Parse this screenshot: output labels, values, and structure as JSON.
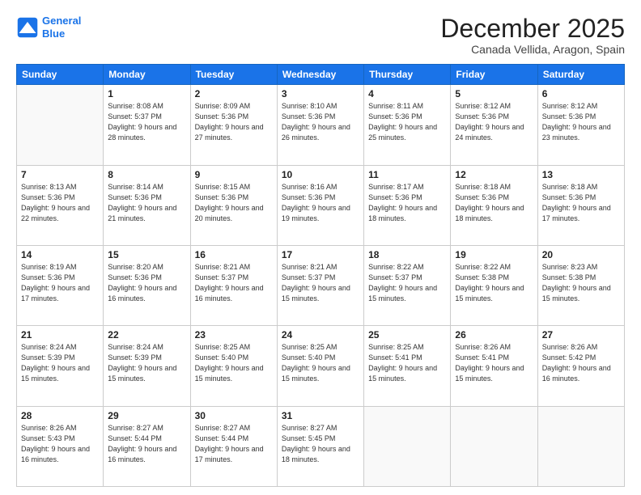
{
  "logo": {
    "line1": "General",
    "line2": "Blue"
  },
  "title": "December 2025",
  "subtitle": "Canada Vellida, Aragon, Spain",
  "weekdays": [
    "Sunday",
    "Monday",
    "Tuesday",
    "Wednesday",
    "Thursday",
    "Friday",
    "Saturday"
  ],
  "weeks": [
    [
      {
        "day": "",
        "info": ""
      },
      {
        "day": "1",
        "info": "Sunrise: 8:08 AM\nSunset: 5:37 PM\nDaylight: 9 hours\nand 28 minutes."
      },
      {
        "day": "2",
        "info": "Sunrise: 8:09 AM\nSunset: 5:36 PM\nDaylight: 9 hours\nand 27 minutes."
      },
      {
        "day": "3",
        "info": "Sunrise: 8:10 AM\nSunset: 5:36 PM\nDaylight: 9 hours\nand 26 minutes."
      },
      {
        "day": "4",
        "info": "Sunrise: 8:11 AM\nSunset: 5:36 PM\nDaylight: 9 hours\nand 25 minutes."
      },
      {
        "day": "5",
        "info": "Sunrise: 8:12 AM\nSunset: 5:36 PM\nDaylight: 9 hours\nand 24 minutes."
      },
      {
        "day": "6",
        "info": "Sunrise: 8:12 AM\nSunset: 5:36 PM\nDaylight: 9 hours\nand 23 minutes."
      }
    ],
    [
      {
        "day": "7",
        "info": "Sunrise: 8:13 AM\nSunset: 5:36 PM\nDaylight: 9 hours\nand 22 minutes."
      },
      {
        "day": "8",
        "info": "Sunrise: 8:14 AM\nSunset: 5:36 PM\nDaylight: 9 hours\nand 21 minutes."
      },
      {
        "day": "9",
        "info": "Sunrise: 8:15 AM\nSunset: 5:36 PM\nDaylight: 9 hours\nand 20 minutes."
      },
      {
        "day": "10",
        "info": "Sunrise: 8:16 AM\nSunset: 5:36 PM\nDaylight: 9 hours\nand 19 minutes."
      },
      {
        "day": "11",
        "info": "Sunrise: 8:17 AM\nSunset: 5:36 PM\nDaylight: 9 hours\nand 18 minutes."
      },
      {
        "day": "12",
        "info": "Sunrise: 8:18 AM\nSunset: 5:36 PM\nDaylight: 9 hours\nand 18 minutes."
      },
      {
        "day": "13",
        "info": "Sunrise: 8:18 AM\nSunset: 5:36 PM\nDaylight: 9 hours\nand 17 minutes."
      }
    ],
    [
      {
        "day": "14",
        "info": "Sunrise: 8:19 AM\nSunset: 5:36 PM\nDaylight: 9 hours\nand 17 minutes."
      },
      {
        "day": "15",
        "info": "Sunrise: 8:20 AM\nSunset: 5:36 PM\nDaylight: 9 hours\nand 16 minutes."
      },
      {
        "day": "16",
        "info": "Sunrise: 8:21 AM\nSunset: 5:37 PM\nDaylight: 9 hours\nand 16 minutes."
      },
      {
        "day": "17",
        "info": "Sunrise: 8:21 AM\nSunset: 5:37 PM\nDaylight: 9 hours\nand 15 minutes."
      },
      {
        "day": "18",
        "info": "Sunrise: 8:22 AM\nSunset: 5:37 PM\nDaylight: 9 hours\nand 15 minutes."
      },
      {
        "day": "19",
        "info": "Sunrise: 8:22 AM\nSunset: 5:38 PM\nDaylight: 9 hours\nand 15 minutes."
      },
      {
        "day": "20",
        "info": "Sunrise: 8:23 AM\nSunset: 5:38 PM\nDaylight: 9 hours\nand 15 minutes."
      }
    ],
    [
      {
        "day": "21",
        "info": "Sunrise: 8:24 AM\nSunset: 5:39 PM\nDaylight: 9 hours\nand 15 minutes."
      },
      {
        "day": "22",
        "info": "Sunrise: 8:24 AM\nSunset: 5:39 PM\nDaylight: 9 hours\nand 15 minutes."
      },
      {
        "day": "23",
        "info": "Sunrise: 8:25 AM\nSunset: 5:40 PM\nDaylight: 9 hours\nand 15 minutes."
      },
      {
        "day": "24",
        "info": "Sunrise: 8:25 AM\nSunset: 5:40 PM\nDaylight: 9 hours\nand 15 minutes."
      },
      {
        "day": "25",
        "info": "Sunrise: 8:25 AM\nSunset: 5:41 PM\nDaylight: 9 hours\nand 15 minutes."
      },
      {
        "day": "26",
        "info": "Sunrise: 8:26 AM\nSunset: 5:41 PM\nDaylight: 9 hours\nand 15 minutes."
      },
      {
        "day": "27",
        "info": "Sunrise: 8:26 AM\nSunset: 5:42 PM\nDaylight: 9 hours\nand 16 minutes."
      }
    ],
    [
      {
        "day": "28",
        "info": "Sunrise: 8:26 AM\nSunset: 5:43 PM\nDaylight: 9 hours\nand 16 minutes."
      },
      {
        "day": "29",
        "info": "Sunrise: 8:27 AM\nSunset: 5:44 PM\nDaylight: 9 hours\nand 16 minutes."
      },
      {
        "day": "30",
        "info": "Sunrise: 8:27 AM\nSunset: 5:44 PM\nDaylight: 9 hours\nand 17 minutes."
      },
      {
        "day": "31",
        "info": "Sunrise: 8:27 AM\nSunset: 5:45 PM\nDaylight: 9 hours\nand 18 minutes."
      },
      {
        "day": "",
        "info": ""
      },
      {
        "day": "",
        "info": ""
      },
      {
        "day": "",
        "info": ""
      }
    ]
  ]
}
